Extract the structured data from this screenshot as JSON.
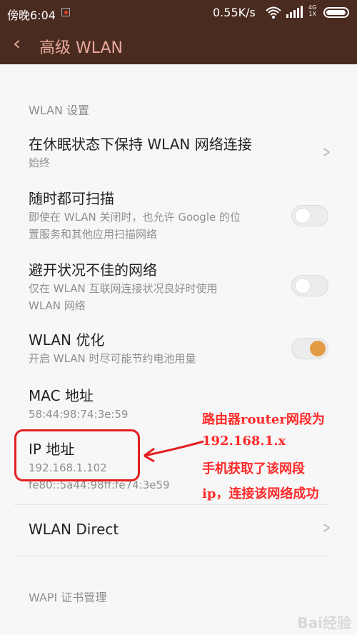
{
  "status_bar": {
    "time": "傍晚6:04",
    "net_speed": "0.55K/s",
    "network_type_top": "4G",
    "network_type_bottom": "1X",
    "wifi_icon": "wifi-icon",
    "battery_icon": "battery-icon"
  },
  "app_bar": {
    "back_icon": "‹",
    "title": "高级 WLAN"
  },
  "section": {
    "header": "WLAN 设置"
  },
  "items": [
    {
      "title": "在休眠状态下保持 WLAN 网络连接",
      "subtitle": "始终"
    },
    {
      "title": "随时都可扫描",
      "subtitle_line1": "即使在 WLAN 关闭时，也允许 Google 的位",
      "subtitle_line2": "置服务和其他应用扫描网络",
      "toggle_on": false
    },
    {
      "title": "避开状况不佳的网络",
      "subtitle_line1": "仅在 WLAN 互联网连接状况良好时使用",
      "subtitle_line2": "WLAN 网络",
      "toggle_on": false
    },
    {
      "title": "WLAN 优化",
      "subtitle": "开启 WLAN 时尽可能节约电池用量",
      "toggle_on": true
    },
    {
      "title": "MAC 地址",
      "subtitle": "58:44:98:74:3e:59"
    },
    {
      "title": "IP 地址",
      "subtitle_line1": "192.168.1.102",
      "subtitle_line2": "fe80::5a44:98ff:fe74:3e59"
    },
    {
      "title": "WLAN Direct"
    },
    {
      "title": "WAPI 证书管理"
    }
  ],
  "annotation": {
    "line1": "路由器router网段为",
    "line2": "192.168.1.x",
    "line3": "手机获取了该网段",
    "line4": "ip，连接该网络成功",
    "color": "#e41f1f"
  },
  "watermark": "Bai经验"
}
